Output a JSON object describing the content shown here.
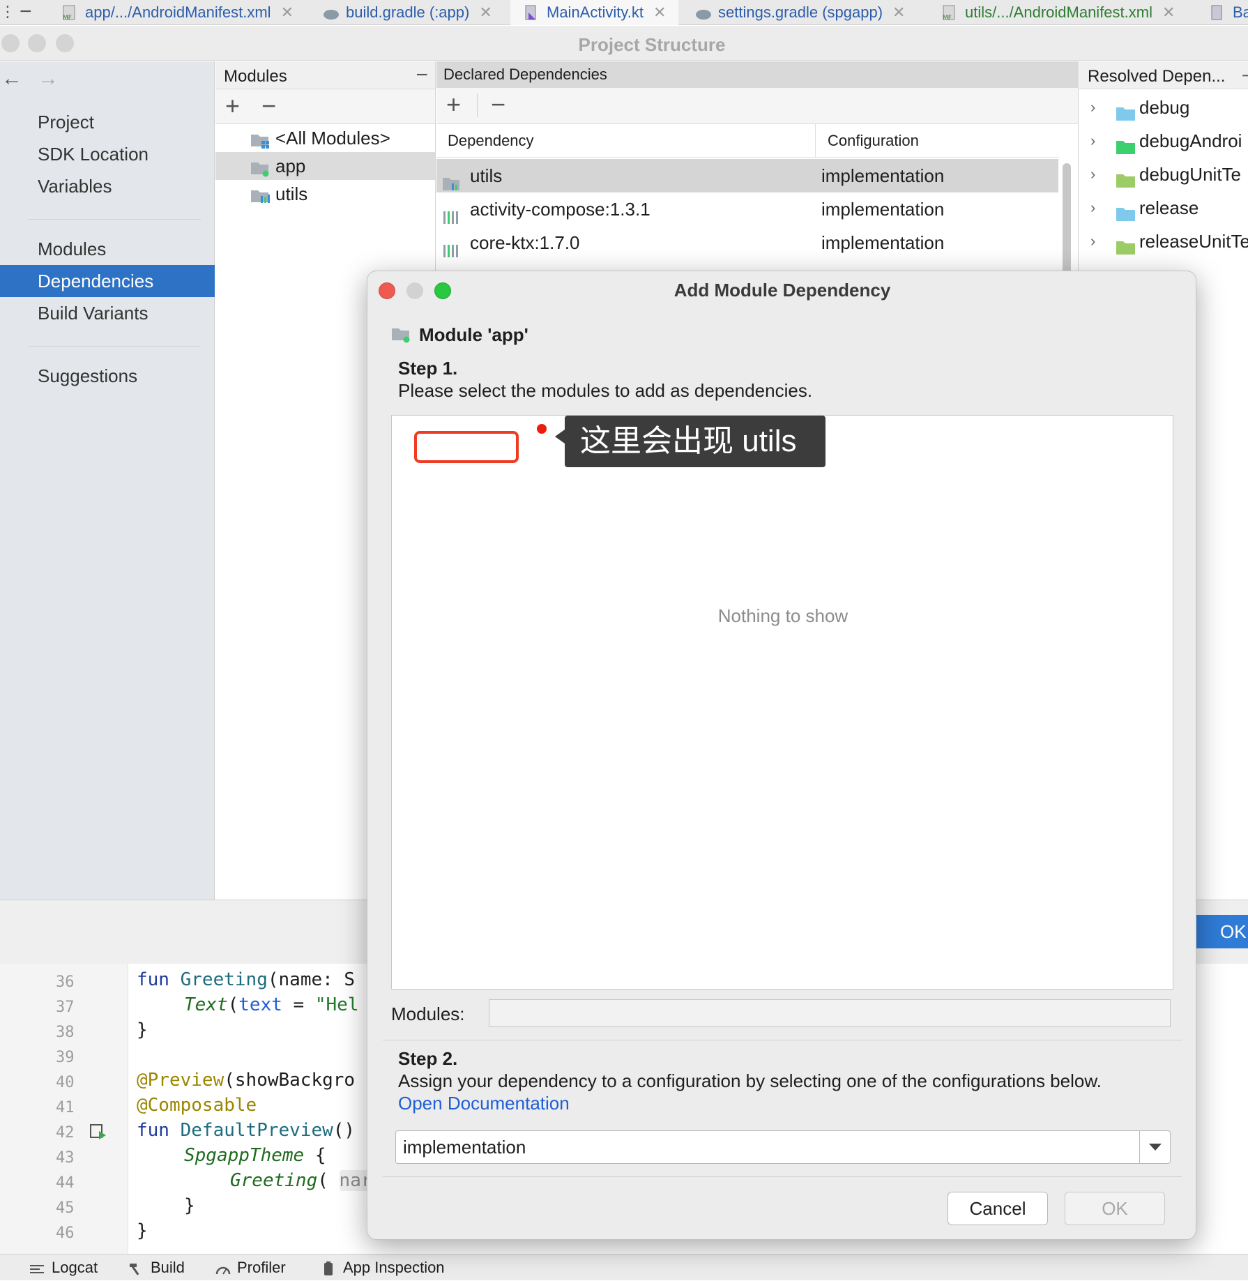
{
  "editor_tabs": [
    {
      "label": "app/.../AndroidManifest.xml",
      "icon": "manifest-icon"
    },
    {
      "label": "build.gradle (:app)",
      "icon": "gradle-icon"
    },
    {
      "label": "MainActivity.kt",
      "icon": "kotlin-file-icon"
    },
    {
      "label": "settings.gradle (spgapp)",
      "icon": "gradle-icon"
    },
    {
      "label": "utils/.../AndroidManifest.xml",
      "icon": "manifest-icon"
    },
    {
      "label": "Ba",
      "icon": "kotlin-file-icon"
    }
  ],
  "project_structure": {
    "title": "Project Structure",
    "sidebar": {
      "group1": [
        "Project",
        "SDK Location",
        "Variables"
      ],
      "group2": [
        "Modules",
        "Dependencies",
        "Build Variants"
      ],
      "group3": [
        "Suggestions"
      ],
      "selected": "Dependencies"
    },
    "modules_pane": {
      "header": "Modules",
      "items": [
        "<All Modules>",
        "app",
        "utils"
      ],
      "selected": "app"
    },
    "declared": {
      "header": "Declared Dependencies",
      "col_dependency": "Dependency",
      "col_configuration": "Configuration",
      "rows": [
        {
          "name": "utils",
          "config": "implementation"
        },
        {
          "name": "activity-compose:1.3.1",
          "config": "implementation"
        },
        {
          "name": "core-ktx:1.7.0",
          "config": "implementation"
        }
      ]
    },
    "resolved": {
      "header": "Resolved Depen...",
      "items": [
        {
          "name": "debug",
          "color": "#7fc9ec"
        },
        {
          "name": "debugAndroi",
          "color": "#3ccf6e"
        },
        {
          "name": "debugUnitTe",
          "color": "#9ccc65"
        },
        {
          "name": "release",
          "color": "#7fc9ec"
        },
        {
          "name": "releaseUnitTe",
          "color": "#9ccc65"
        }
      ]
    },
    "ok_label": "OK"
  },
  "code": {
    "lines": [
      {
        "n": "36"
      },
      {
        "n": "37"
      },
      {
        "n": "38"
      },
      {
        "n": "39"
      },
      {
        "n": "40"
      },
      {
        "n": "41"
      },
      {
        "n": "42"
      },
      {
        "n": "43"
      },
      {
        "n": "44"
      },
      {
        "n": "45"
      },
      {
        "n": "46"
      }
    ],
    "l36_kw": "fun ",
    "l36_fn": "Greeting",
    "l36_rest": "(name: S",
    "l37_fn": "Text",
    "l37_p": "(",
    "l37_arg": "text",
    "l37_eq": " = ",
    "l37_str": "\"Hel",
    "l38": "}",
    "l40_ann": "@Preview",
    "l40_rest": "(showBackgro",
    "l41_ann": "@Composable",
    "l42_kw": "fun ",
    "l42_fn": "DefaultPreview",
    "l42_rest": "()",
    "l43_fn": "SpgappTheme",
    "l43_rest": " {",
    "l44_fn": "Greeting",
    "l44_rest": "( ",
    "l44_hint": "nar",
    "l45": "}",
    "l46": "}"
  },
  "statusbar": [
    "Logcat",
    "Build",
    "Profiler",
    "App Inspection"
  ],
  "dialog": {
    "title": "Add Module Dependency",
    "module_label": "Module 'app'",
    "step1_title": "Step 1.",
    "step1_desc": "Please select the modules to add as dependencies.",
    "empty_text": "Nothing to show",
    "annotation": "这里会出现 utils",
    "modules_label": "Modules:",
    "step2_title": "Step 2.",
    "step2_desc": "Assign your dependency to a configuration by selecting one of the configurations below.",
    "doc_link": "Open Documentation",
    "configuration_value": "implementation",
    "cancel_label": "Cancel",
    "ok_label": "OK"
  },
  "colors": {
    "selection": "#2d72c4",
    "annotation_red": "#ee3b22",
    "link": "#1f5ed6"
  }
}
